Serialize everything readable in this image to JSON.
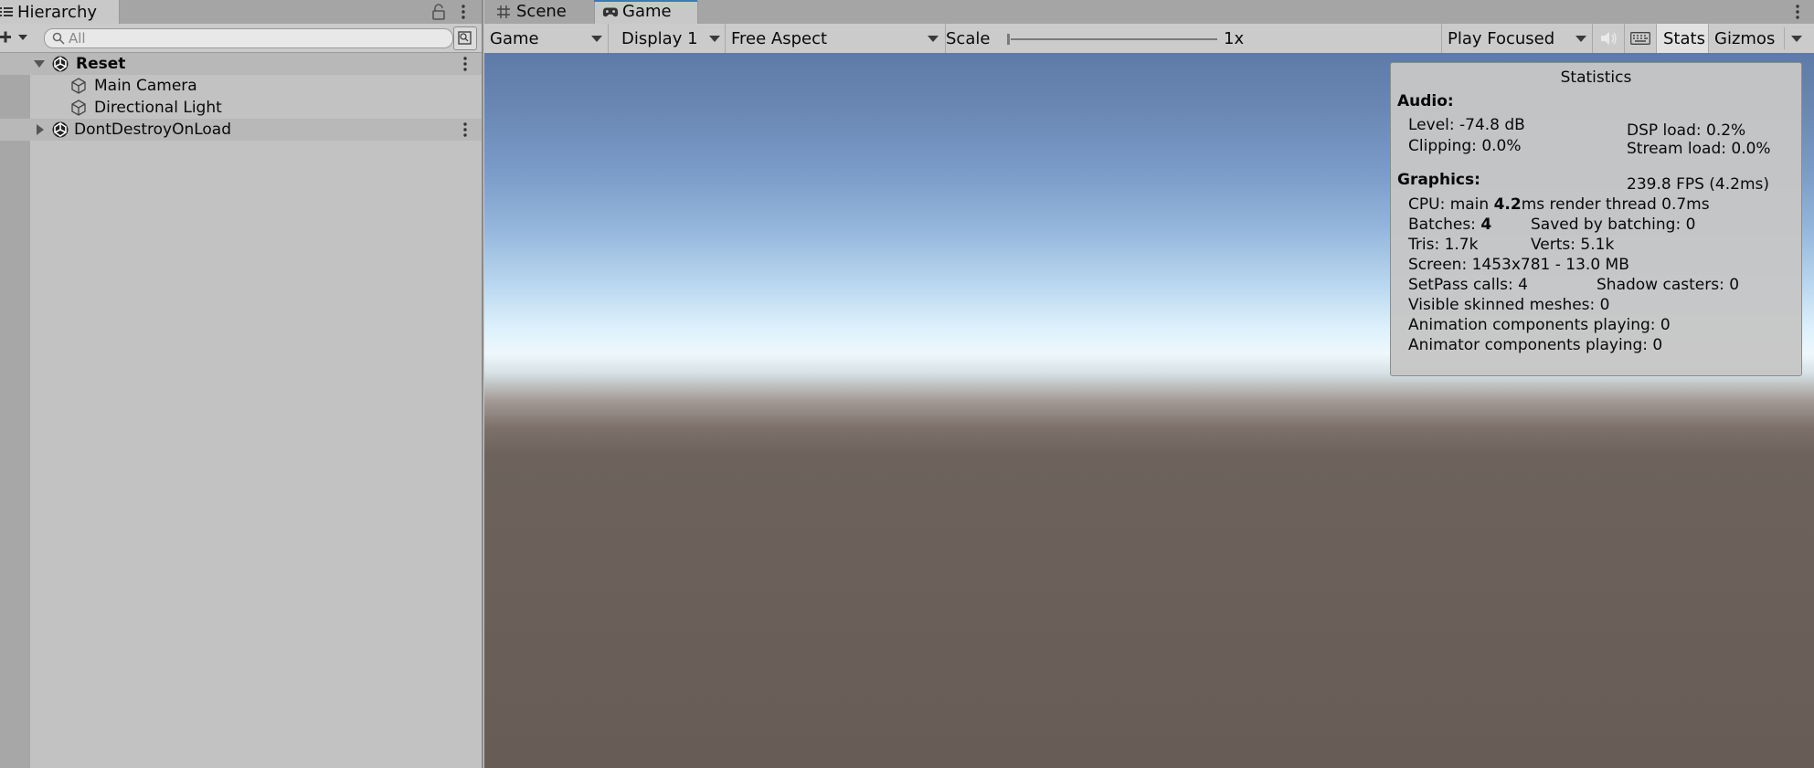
{
  "hierarchy": {
    "tab_label": "Hierarchy",
    "search_placeholder": "All",
    "rows": [
      {
        "label": "Reset",
        "expanded": true,
        "kind": "scene"
      },
      {
        "label": "Main Camera",
        "kind": "gameobject"
      },
      {
        "label": "Directional Light",
        "kind": "gameobject"
      },
      {
        "label": "DontDestroyOnLoad",
        "expanded": false,
        "kind": "scene"
      }
    ]
  },
  "game_view": {
    "tabs": [
      {
        "label": "Scene",
        "icon": "hash-grid-icon",
        "active": false
      },
      {
        "label": "Game",
        "icon": "gamepad-icon",
        "active": true
      }
    ],
    "toolbar": {
      "view_dropdown": "Game",
      "display_dropdown": "Display 1",
      "aspect_dropdown": "Free Aspect",
      "scale_label": "Scale",
      "scale_value": "1x",
      "play_mode_dropdown": "Play Focused",
      "stats_label": "Stats",
      "gizmos_label": "Gizmos"
    }
  },
  "statistics": {
    "title": "Statistics",
    "audio_header": "Audio:",
    "level": "Level: -74.8 dB",
    "clipping": "Clipping: 0.0%",
    "dsp_load": "DSP load: 0.2%",
    "stream_load": "Stream load: 0.0%",
    "graphics_header": "Graphics:",
    "fps": "239.8 FPS (4.2ms)",
    "cpu_prefix": "CPU: main ",
    "cpu_main": "4.2",
    "cpu_suffix": "ms  render thread 0.7ms",
    "batches_prefix": "Batches: ",
    "batches_value": "4",
    "saved_by_batching": "Saved by batching: 0",
    "tris": "Tris: 1.7k",
    "verts": "Verts: 5.1k",
    "screen": "Screen: 1453x781 - 13.0 MB",
    "setpass": "SetPass calls: 4",
    "shadow_casters": "Shadow casters: 0",
    "skinned_meshes": "Visible skinned meshes: 0",
    "animation_components": "Animation components playing: 0",
    "animator_components": "Animator components playing: 0"
  },
  "colors": {
    "panel_bg": "#c2c2c2",
    "toolbar_bg": "#cbcbcb",
    "active_tab_accent": "#3a79bb",
    "sky_top": "#5e7aa6",
    "horizon": "#eef8fc",
    "ground": "#685c56"
  }
}
